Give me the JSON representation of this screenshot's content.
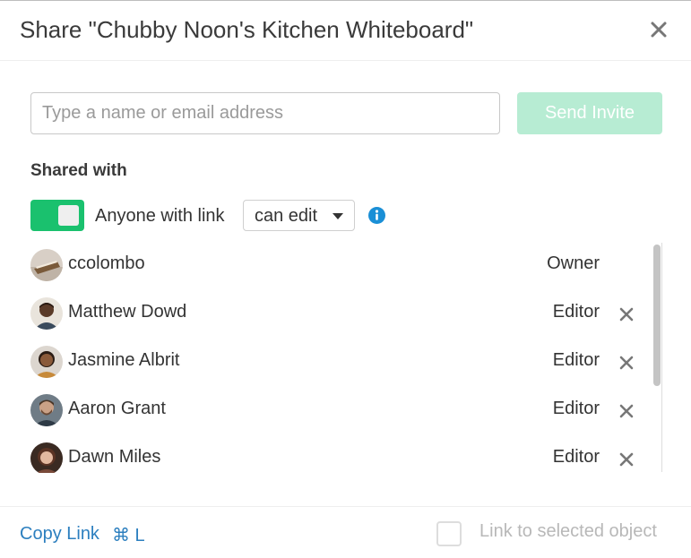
{
  "dialog": {
    "title": "Share \"Chubby Noon's Kitchen Whiteboard\"",
    "close_icon": "close-icon"
  },
  "invite": {
    "placeholder": "Type a name or email address",
    "value": "",
    "send_label": "Send Invite"
  },
  "shared_with": {
    "title": "Shared with",
    "link_toggle_on": true,
    "link_label": "Anyone with link",
    "permission": "can edit",
    "info_icon": "info-icon"
  },
  "members": [
    {
      "name": "ccolombo",
      "role": "Owner",
      "removable": false
    },
    {
      "name": "Matthew Dowd",
      "role": "Editor",
      "removable": true
    },
    {
      "name": "Jasmine Albrit",
      "role": "Editor",
      "removable": true
    },
    {
      "name": "Aaron Grant",
      "role": "Editor",
      "removable": true
    },
    {
      "name": "Dawn Miles",
      "role": "Editor",
      "removable": true
    }
  ],
  "footer": {
    "copy_link_label": "Copy Link",
    "shortcut": "⌘ L",
    "link_to_selected_label": "Link to selected object",
    "link_to_selected_checked": false
  },
  "colors": {
    "accent_green": "#1ac16e",
    "send_button_disabled": "#b7ecd3",
    "link_blue": "#2c7fbf",
    "info_blue": "#1a8fd6"
  }
}
